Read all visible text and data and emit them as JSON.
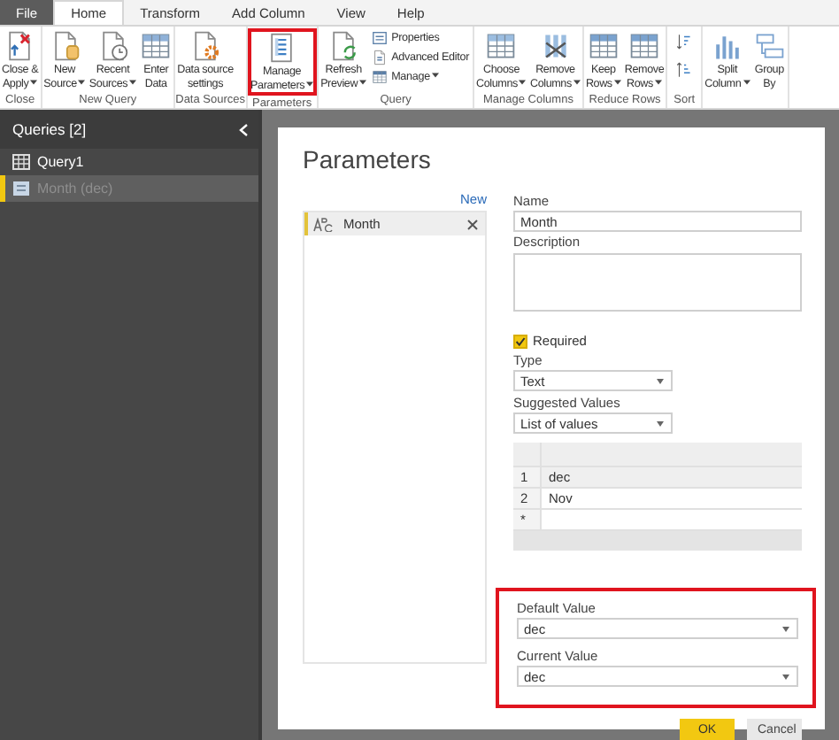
{
  "tabs": [
    {
      "label": "File",
      "kind": "file",
      "selected": false
    },
    {
      "label": "Home",
      "kind": "tab",
      "selected": true
    },
    {
      "label": "Transform",
      "kind": "tab",
      "selected": false
    },
    {
      "label": "Add Column",
      "kind": "tab",
      "selected": false
    },
    {
      "label": "View",
      "kind": "tab",
      "selected": false
    },
    {
      "label": "Help",
      "kind": "tab",
      "selected": false
    }
  ],
  "ribbon": {
    "groups": [
      {
        "label": "Close",
        "buttons": [
          {
            "kind": "large",
            "lines": [
              "Close &",
              "Apply"
            ],
            "dropdown": true
          }
        ]
      },
      {
        "label": "New Query",
        "buttons": [
          {
            "kind": "large",
            "lines": [
              "New",
              "Source"
            ],
            "dropdown": true
          },
          {
            "kind": "large",
            "lines": [
              "Recent",
              "Sources"
            ],
            "dropdown": true
          },
          {
            "kind": "large",
            "lines": [
              "Enter",
              "Data"
            ],
            "dropdown": false
          }
        ]
      },
      {
        "label": "Data Sources",
        "buttons": [
          {
            "kind": "large",
            "lines": [
              "Data source",
              "settings"
            ],
            "dropdown": false
          }
        ]
      },
      {
        "label": "Parameters",
        "buttons": [
          {
            "kind": "large",
            "lines": [
              "Manage",
              "Parameters"
            ],
            "dropdown": true,
            "highlighted": true
          }
        ]
      },
      {
        "label": "Query",
        "buttons": [
          {
            "kind": "large",
            "lines": [
              "Refresh",
              "Preview"
            ],
            "dropdown": true
          },
          {
            "kind": "small",
            "lines": [
              "Properties"
            ],
            "dropdown": false
          },
          {
            "kind": "small",
            "lines": [
              "Advanced Editor"
            ],
            "dropdown": false
          },
          {
            "kind": "small",
            "lines": [
              "Manage"
            ],
            "dropdown": true
          }
        ]
      },
      {
        "label": "Manage Columns",
        "buttons": [
          {
            "kind": "large",
            "lines": [
              "Choose",
              "Columns"
            ],
            "dropdown": true
          },
          {
            "kind": "large",
            "lines": [
              "Remove",
              "Columns"
            ],
            "dropdown": true
          }
        ]
      },
      {
        "label": "Reduce Rows",
        "buttons": [
          {
            "kind": "large",
            "lines": [
              "Keep",
              "Rows"
            ],
            "dropdown": true
          },
          {
            "kind": "large",
            "lines": [
              "Remove",
              "Rows"
            ],
            "dropdown": true
          }
        ]
      },
      {
        "label": "Sort",
        "buttons": [
          {
            "kind": "icon",
            "dropdown": false
          },
          {
            "kind": "icon",
            "dropdown": false
          }
        ]
      },
      {
        "buttons": [
          {
            "kind": "large",
            "lines": [
              "Split",
              "Column"
            ],
            "dropdown": true
          },
          {
            "kind": "large",
            "lines": [
              "Group",
              "By"
            ],
            "dropdown": false
          }
        ]
      }
    ]
  },
  "queries": {
    "title": "Queries [2]",
    "items": [
      {
        "label": "Query1",
        "kind": "table",
        "selected": false
      },
      {
        "label": "Month (dec)",
        "kind": "parameter",
        "selected": true
      }
    ]
  },
  "dialog": {
    "title": "Parameters",
    "new_link": "New",
    "parameters": [
      {
        "name": "Month",
        "selected": true
      }
    ],
    "name": {
      "label": "Name",
      "value": "Month"
    },
    "description": {
      "label": "Description"
    },
    "required": {
      "label": "Required",
      "checked": true
    },
    "type": {
      "label": "Type",
      "value": "Text"
    },
    "suggested_values": {
      "label": "Suggested Values",
      "value": "List of values"
    },
    "values_table": {
      "rows": [
        {
          "index": "1",
          "value": "dec",
          "selected": true
        },
        {
          "index": "2",
          "value": "Nov",
          "selected": false
        }
      ],
      "new_row_marker": "*"
    },
    "values_highlighted": true,
    "default_value": {
      "label": "Default Value",
      "value": "dec"
    },
    "current_value": {
      "label": "Current Value",
      "value": "dec"
    },
    "buttons": [
      {
        "label": "OK",
        "kind": "primary"
      },
      {
        "label": "Cancel",
        "kind": "secondary"
      }
    ]
  }
}
